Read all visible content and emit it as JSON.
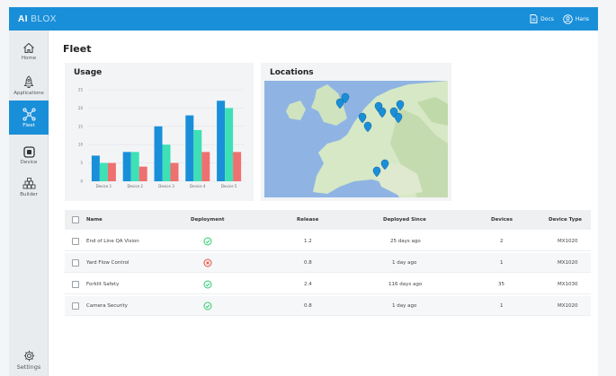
{
  "app": {
    "brand_a": "AI",
    "brand_b": "BLOX",
    "docs_label": "Docs",
    "user_label": "Hans",
    "accent": "#1a8fd9"
  },
  "sidebar": {
    "items": [
      {
        "label": "Home",
        "icon": "home-icon"
      },
      {
        "label": "Applications",
        "icon": "rocket-icon"
      },
      {
        "label": "Fleet",
        "icon": "network-icon",
        "active": true
      },
      {
        "label": "Device",
        "icon": "chip-icon"
      },
      {
        "label": "Builder",
        "icon": "blocks-icon"
      },
      {
        "label": "Settings",
        "icon": "gear-icon"
      }
    ]
  },
  "page": {
    "title": "Fleet"
  },
  "usage": {
    "title": "Usage"
  },
  "locations": {
    "title": "Locations"
  },
  "chart_data": {
    "type": "bar",
    "categories": [
      "Device 1",
      "Device 2",
      "Device 3",
      "Device 4",
      "Device 5"
    ],
    "series": [
      {
        "values": [
          7,
          8,
          15,
          18,
          22
        ],
        "color": "#1a8fd9"
      },
      {
        "values": [
          5,
          8,
          10,
          14,
          20
        ],
        "color": "#3ee0b5"
      },
      {
        "values": [
          5,
          4,
          5,
          8,
          8
        ],
        "color": "#ee7070"
      }
    ],
    "ylim": [
      0,
      25
    ],
    "yticks": [
      "0",
      "5",
      "10",
      "15",
      "20",
      "25"
    ],
    "title": "",
    "xlabel": "",
    "ylabel": ""
  },
  "table": {
    "headers": [
      "Name",
      "Deployment",
      "Release",
      "Deployed Since",
      "Devices",
      "Device Type"
    ],
    "rows": [
      {
        "name": "End of Line QA Vision",
        "deployment": "ok",
        "release": "1.2",
        "since": "25 days ago",
        "devices": "2",
        "type": "MX1020"
      },
      {
        "name": "Yard Flow Control",
        "deployment": "error",
        "release": "0.8",
        "since": "1 day ago",
        "devices": "1",
        "type": "MX1020"
      },
      {
        "name": "Forklit Safety",
        "deployment": "ok",
        "release": "2.4",
        "since": "116 days ago",
        "devices": "35",
        "type": "MX1030"
      },
      {
        "name": "Camera Security",
        "deployment": "ok",
        "release": "0.8",
        "since": "1 day ago",
        "devices": "1",
        "type": "MX1020"
      }
    ],
    "status_colors": {
      "ok": "#2ecc71",
      "error": "#e74c3c"
    }
  }
}
